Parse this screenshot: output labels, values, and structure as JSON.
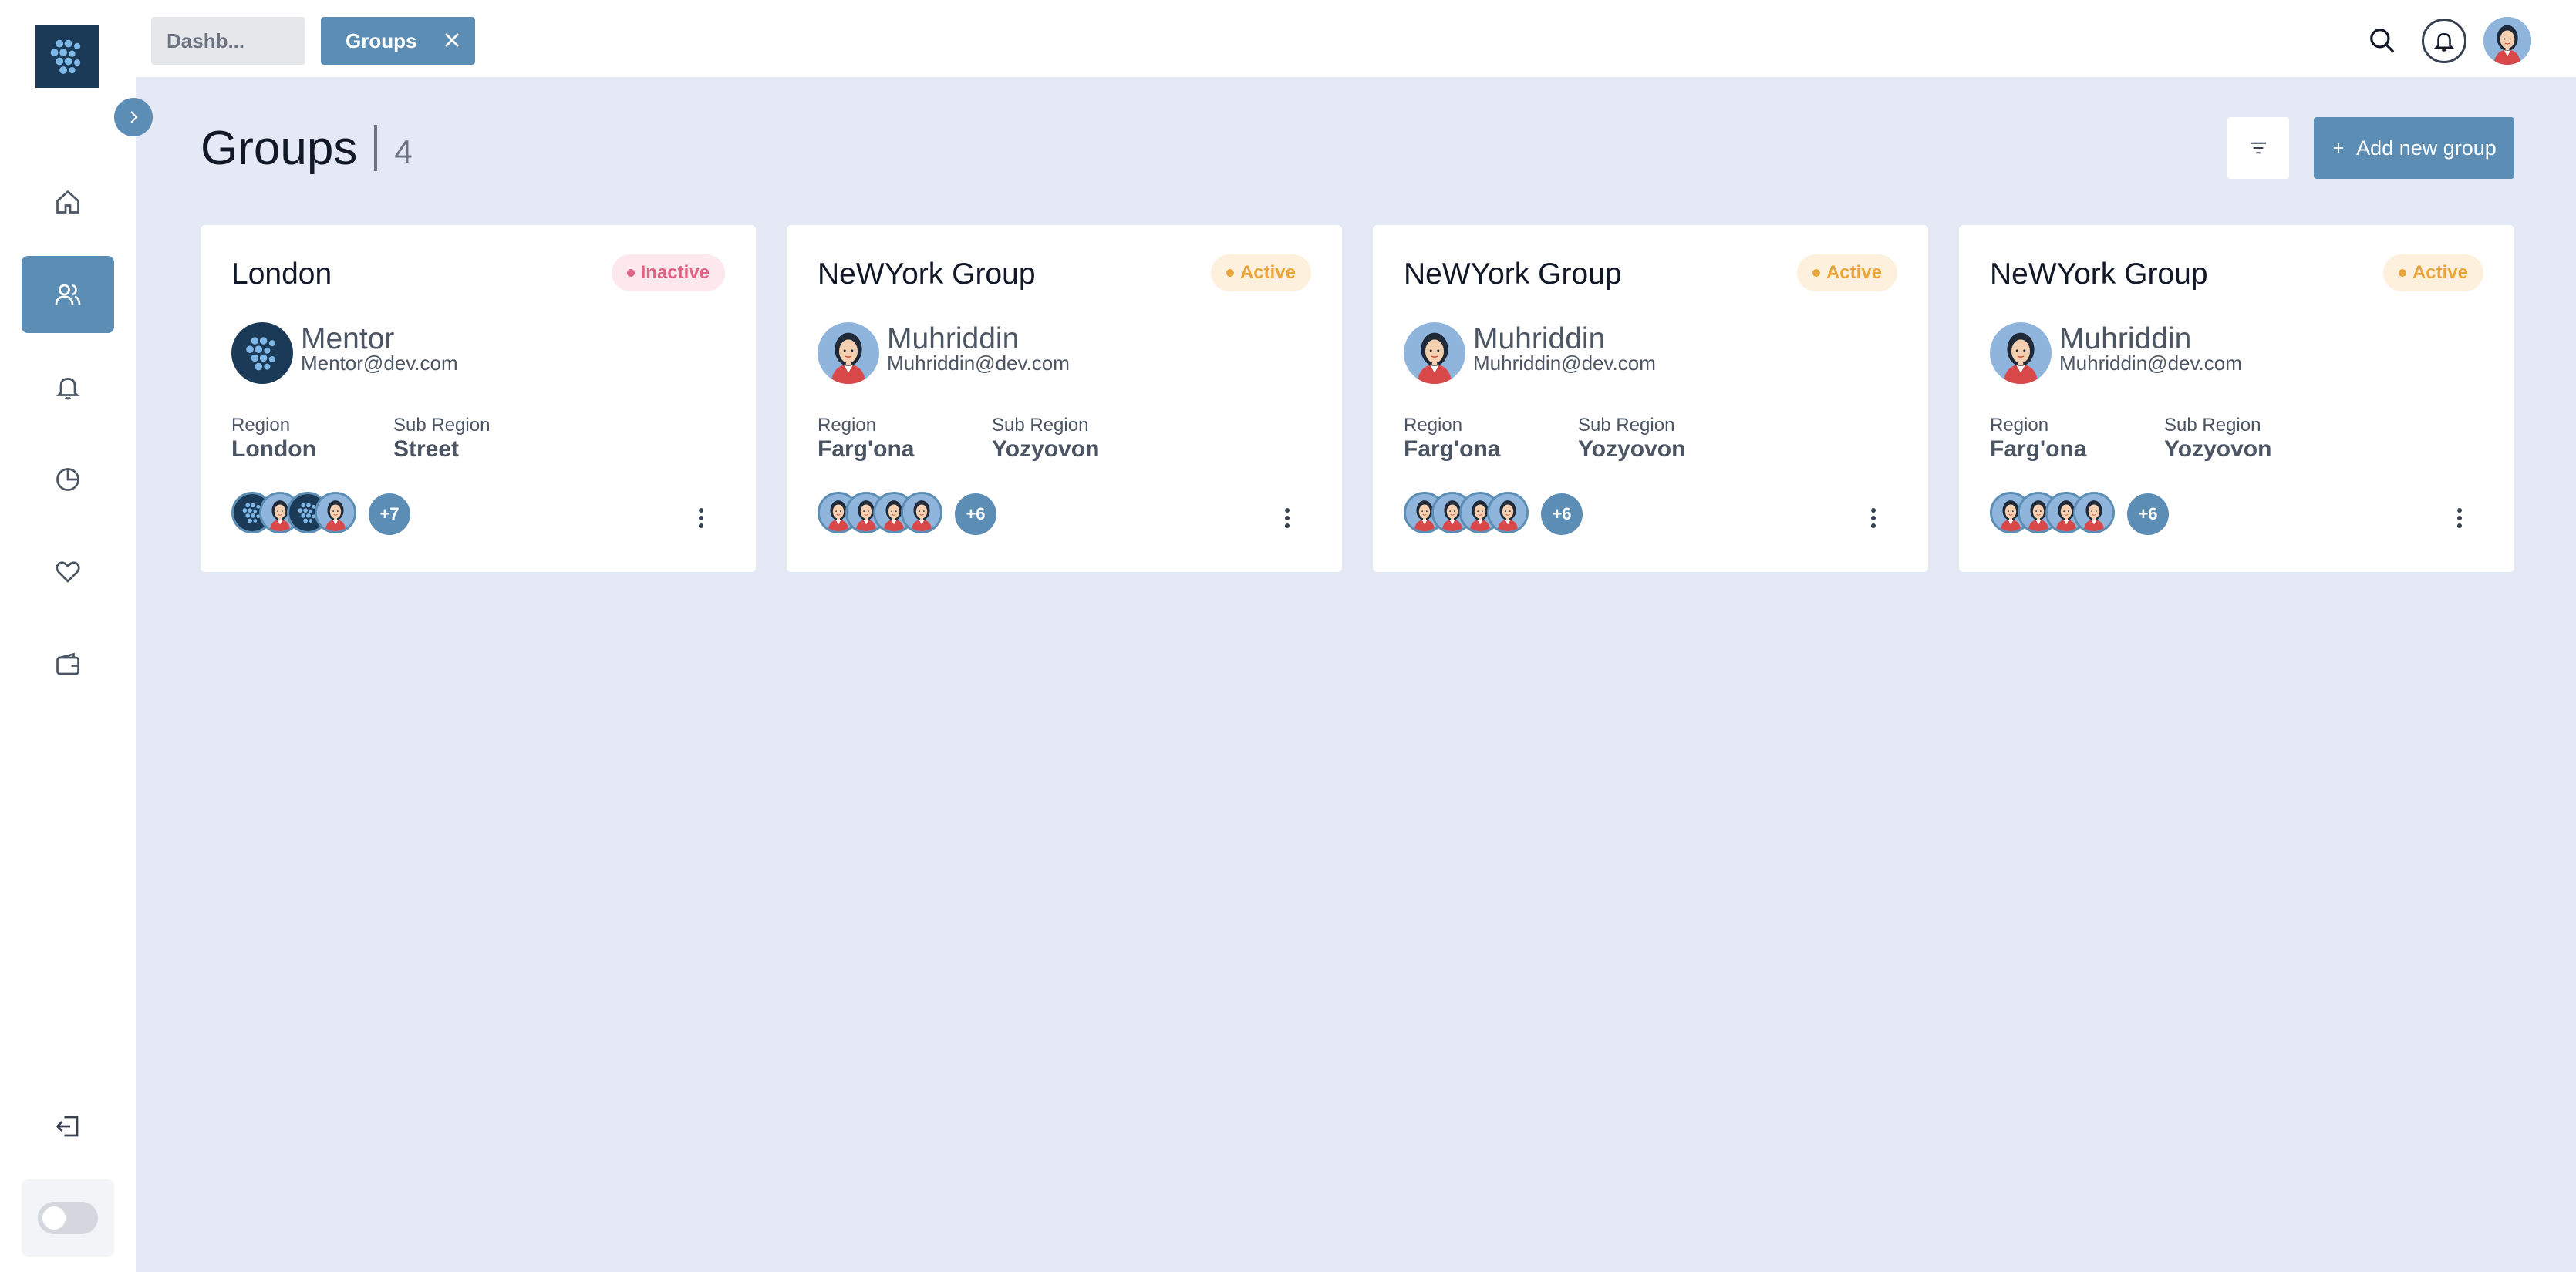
{
  "tabs": [
    {
      "label": "Dashb..."
    },
    {
      "label": "Groups"
    }
  ],
  "page": {
    "title": "Groups",
    "count": "4",
    "add_label": "Add new group"
  },
  "cards": [
    {
      "title": "London",
      "status": "Inactive",
      "owner_name": "Mentor",
      "owner_email": "Mentor@dev.com",
      "region_label": "Region",
      "region": "London",
      "subregion_label": "Sub Region",
      "subregion": "Street",
      "more": "+7"
    },
    {
      "title": "NeWYork Group",
      "status": "Active",
      "owner_name": "Muhriddin",
      "owner_email": "Muhriddin@dev.com",
      "region_label": "Region",
      "region": "Farg'ona",
      "subregion_label": "Sub Region",
      "subregion": "Yozyovon",
      "more": "+6"
    },
    {
      "title": "NeWYork Group",
      "status": "Active",
      "owner_name": "Muhriddin",
      "owner_email": "Muhriddin@dev.com",
      "region_label": "Region",
      "region": "Farg'ona",
      "subregion_label": "Sub Region",
      "subregion": "Yozyovon",
      "more": "+6"
    },
    {
      "title": "NeWYork Group",
      "status": "Active",
      "owner_name": "Muhriddin",
      "owner_email": "Muhriddin@dev.com",
      "region_label": "Region",
      "region": "Farg'ona",
      "subregion_label": "Sub Region",
      "subregion": "Yozyovon",
      "more": "+6"
    }
  ],
  "icons": {
    "sidebar": [
      "home-icon",
      "users-icon",
      "bell-icon",
      "pie-chart-icon",
      "heart-icon",
      "wallet-icon"
    ],
    "logout": "logout-icon",
    "search": "search-icon",
    "notifications": "bell-icon",
    "filter": "filter-icon",
    "add": "plus-icon",
    "close": "close-icon",
    "menu": "more-vertical-icon"
  },
  "colors": {
    "accent": "#5b8db5",
    "background": "#e4e9f5",
    "inactive": "#e06283",
    "active": "#eaa53a"
  }
}
